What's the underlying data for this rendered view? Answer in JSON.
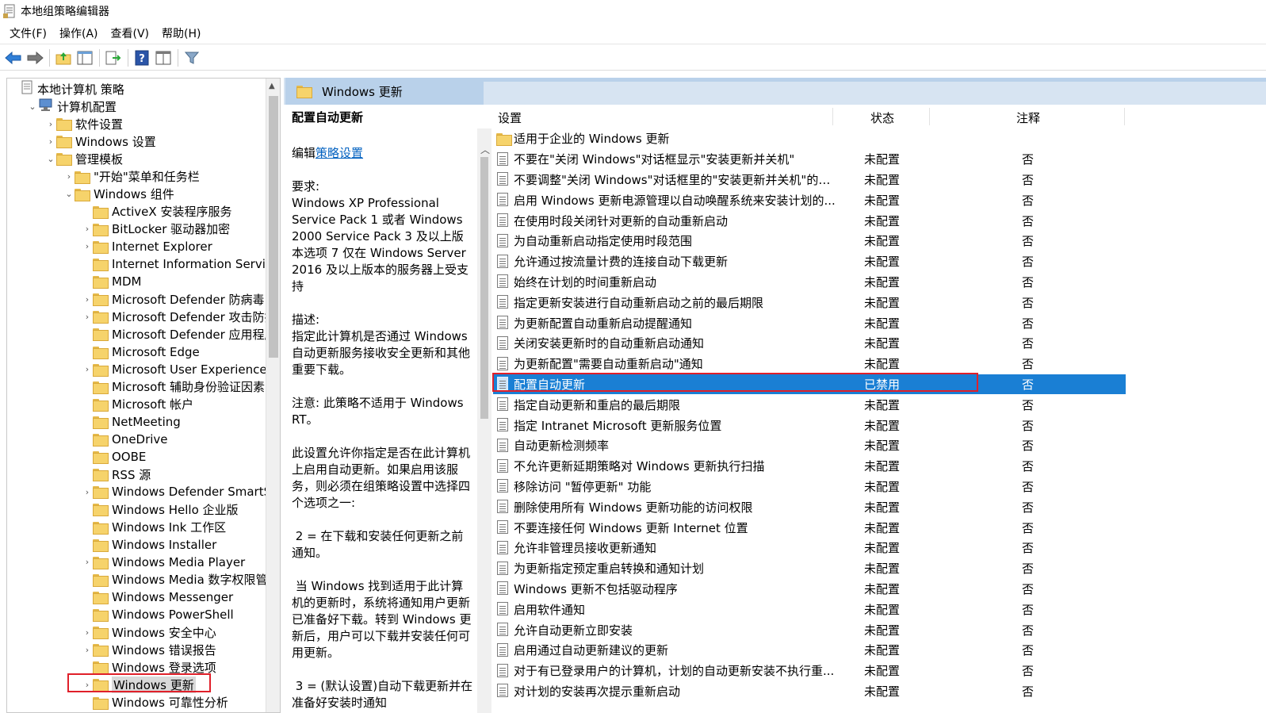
{
  "window": {
    "title": "本地组策略编辑器"
  },
  "menu": [
    "文件(F)",
    "操作(A)",
    "查看(V)",
    "帮助(H)"
  ],
  "toolbar": {
    "buttons": [
      {
        "name": "back-arrow-icon"
      },
      {
        "name": "forward-arrow-icon"
      },
      {
        "name": "up-folder-icon"
      },
      {
        "name": "show-hide-tree-icon"
      },
      {
        "name": "export-list-icon"
      },
      {
        "name": "help-icon"
      },
      {
        "name": "properties-view-icon"
      },
      {
        "name": "filter-icon"
      }
    ]
  },
  "tree": {
    "items": [
      {
        "label": "本地计算机 策略",
        "level": 0,
        "expander": "",
        "icon": "policy"
      },
      {
        "label": "计算机配置",
        "level": 1,
        "expander": "⌄",
        "icon": "computer"
      },
      {
        "label": "软件设置",
        "level": 2,
        "expander": "›",
        "icon": "folder"
      },
      {
        "label": "Windows 设置",
        "level": 2,
        "expander": "›",
        "icon": "folder"
      },
      {
        "label": "管理模板",
        "level": 2,
        "expander": "⌄",
        "icon": "folder"
      },
      {
        "label": "\"开始\"菜单和任务栏",
        "level": 3,
        "expander": "›",
        "icon": "folder"
      },
      {
        "label": "Windows 组件",
        "level": 3,
        "expander": "⌄",
        "icon": "folder"
      },
      {
        "label": "ActiveX 安装程序服务",
        "level": 4,
        "expander": "",
        "icon": "folder"
      },
      {
        "label": "BitLocker 驱动器加密",
        "level": 4,
        "expander": "›",
        "icon": "folder"
      },
      {
        "label": "Internet Explorer",
        "level": 4,
        "expander": "›",
        "icon": "folder"
      },
      {
        "label": "Internet Information Services",
        "level": 4,
        "expander": "",
        "icon": "folder"
      },
      {
        "label": "MDM",
        "level": 4,
        "expander": "",
        "icon": "folder"
      },
      {
        "label": "Microsoft Defender 防病毒",
        "level": 4,
        "expander": "›",
        "icon": "folder"
      },
      {
        "label": "Microsoft Defender 攻击防护",
        "level": 4,
        "expander": "›",
        "icon": "folder"
      },
      {
        "label": "Microsoft Defender 应用程序防",
        "level": 4,
        "expander": "",
        "icon": "folder"
      },
      {
        "label": "Microsoft Edge",
        "level": 4,
        "expander": "",
        "icon": "folder"
      },
      {
        "label": "Microsoft User Experience Virt",
        "level": 4,
        "expander": "›",
        "icon": "folder"
      },
      {
        "label": "Microsoft 辅助身份验证因素",
        "level": 4,
        "expander": "",
        "icon": "folder"
      },
      {
        "label": "Microsoft 帐户",
        "level": 4,
        "expander": "",
        "icon": "folder"
      },
      {
        "label": "NetMeeting",
        "level": 4,
        "expander": "",
        "icon": "folder"
      },
      {
        "label": "OneDrive",
        "level": 4,
        "expander": "",
        "icon": "folder"
      },
      {
        "label": "OOBE",
        "level": 4,
        "expander": "",
        "icon": "folder"
      },
      {
        "label": "RSS 源",
        "level": 4,
        "expander": "",
        "icon": "folder"
      },
      {
        "label": "Windows Defender SmartScre",
        "level": 4,
        "expander": "›",
        "icon": "folder"
      },
      {
        "label": "Windows Hello 企业版",
        "level": 4,
        "expander": "",
        "icon": "folder"
      },
      {
        "label": "Windows Ink 工作区",
        "level": 4,
        "expander": "",
        "icon": "folder"
      },
      {
        "label": "Windows Installer",
        "level": 4,
        "expander": "",
        "icon": "folder"
      },
      {
        "label": "Windows Media Player",
        "level": 4,
        "expander": "›",
        "icon": "folder"
      },
      {
        "label": "Windows Media 数字权限管理",
        "level": 4,
        "expander": "",
        "icon": "folder"
      },
      {
        "label": "Windows Messenger",
        "level": 4,
        "expander": "",
        "icon": "folder"
      },
      {
        "label": "Windows PowerShell",
        "level": 4,
        "expander": "",
        "icon": "folder"
      },
      {
        "label": "Windows 安全中心",
        "level": 4,
        "expander": "›",
        "icon": "folder"
      },
      {
        "label": "Windows 错误报告",
        "level": 4,
        "expander": "›",
        "icon": "folder"
      },
      {
        "label": "Windows 登录选项",
        "level": 4,
        "expander": "",
        "icon": "folder"
      },
      {
        "label": "Windows 更新",
        "level": 4,
        "expander": "›",
        "icon": "folder",
        "selected": true
      },
      {
        "label": "Windows 可靠性分析",
        "level": 4,
        "expander": "",
        "icon": "folder"
      }
    ]
  },
  "header": {
    "title": "Windows 更新"
  },
  "description": {
    "title": "配置自动更新",
    "edit_prefix": "编辑",
    "edit_link": "策略设置",
    "requirements": "要求:\nWindows XP Professional Service Pack 1 或者 Windows 2000 Service Pack 3 及以上版本选项 7 仅在 Windows Server 2016 及以上版本的服务器上受支持",
    "description_text": "描述:\n指定此计算机是否通过 Windows 自动更新服务接收安全更新和其他重要下载。",
    "note": "注意: 此策略不适用于 Windows RT。",
    "p1": "此设置允许你指定是否在此计算机上启用自动更新。如果启用该服务，则必须在组策略设置中选择四个选项之一:",
    "p2": " 2 = 在下载和安装任何更新之前通知。",
    "p3": " 当 Windows 找到适用于此计算机的更新时，系统将通知用户更新已准备好下载。转到 Windows 更新后，用户可以下载并安装任何可用更新。",
    "p4": " 3 = (默认设置)自动下载更新并在准备好安装时通知"
  },
  "list": {
    "columns": {
      "setting": "设置",
      "state": "状态",
      "comment": "注释"
    },
    "rows": [
      {
        "name": "适用于企业的 Windows 更新",
        "state": "",
        "comment": "",
        "icon": "folder"
      },
      {
        "name": "不要在\"关闭 Windows\"对话框显示\"安装更新并关机\"",
        "state": "未配置",
        "comment": "否",
        "icon": "policy"
      },
      {
        "name": "不要调整\"关闭 Windows\"对话框里的\"安装更新并关机\"的默...",
        "state": "未配置",
        "comment": "否",
        "icon": "policy"
      },
      {
        "name": "启用 Windows 更新电源管理以自动唤醒系统来安装计划的...",
        "state": "未配置",
        "comment": "否",
        "icon": "policy"
      },
      {
        "name": "在使用时段关闭针对更新的自动重新启动",
        "state": "未配置",
        "comment": "否",
        "icon": "policy"
      },
      {
        "name": "为自动重新启动指定使用时段范围",
        "state": "未配置",
        "comment": "否",
        "icon": "policy"
      },
      {
        "name": "允许通过按流量计费的连接自动下载更新",
        "state": "未配置",
        "comment": "否",
        "icon": "policy"
      },
      {
        "name": "始终在计划的时间重新启动",
        "state": "未配置",
        "comment": "否",
        "icon": "policy"
      },
      {
        "name": "指定更新安装进行自动重新启动之前的最后期限",
        "state": "未配置",
        "comment": "否",
        "icon": "policy"
      },
      {
        "name": "为更新配置自动重新启动提醒通知",
        "state": "未配置",
        "comment": "否",
        "icon": "policy"
      },
      {
        "name": "关闭安装更新时的自动重新启动通知",
        "state": "未配置",
        "comment": "否",
        "icon": "policy"
      },
      {
        "name": "为更新配置\"需要自动重新启动\"通知",
        "state": "未配置",
        "comment": "否",
        "icon": "policy"
      },
      {
        "name": "配置自动更新",
        "state": "已禁用",
        "comment": "否",
        "icon": "policy",
        "selected": true
      },
      {
        "name": "指定自动更新和重启的最后期限",
        "state": "未配置",
        "comment": "否",
        "icon": "policy"
      },
      {
        "name": "指定 Intranet Microsoft 更新服务位置",
        "state": "未配置",
        "comment": "否",
        "icon": "policy"
      },
      {
        "name": "自动更新检测频率",
        "state": "未配置",
        "comment": "否",
        "icon": "policy"
      },
      {
        "name": "不允许更新延期策略对 Windows 更新执行扫描",
        "state": "未配置",
        "comment": "否",
        "icon": "policy"
      },
      {
        "name": "移除访问 \"暂停更新\" 功能",
        "state": "未配置",
        "comment": "否",
        "icon": "policy"
      },
      {
        "name": "删除使用所有 Windows 更新功能的访问权限",
        "state": "未配置",
        "comment": "否",
        "icon": "policy"
      },
      {
        "name": "不要连接任何 Windows 更新 Internet 位置",
        "state": "未配置",
        "comment": "否",
        "icon": "policy"
      },
      {
        "name": "允许非管理员接收更新通知",
        "state": "未配置",
        "comment": "否",
        "icon": "policy"
      },
      {
        "name": "为更新指定预定重启转换和通知计划",
        "state": "未配置",
        "comment": "否",
        "icon": "policy"
      },
      {
        "name": "Windows 更新不包括驱动程序",
        "state": "未配置",
        "comment": "否",
        "icon": "policy"
      },
      {
        "name": "启用软件通知",
        "state": "未配置",
        "comment": "否",
        "icon": "policy"
      },
      {
        "name": "允许自动更新立即安装",
        "state": "未配置",
        "comment": "否",
        "icon": "policy"
      },
      {
        "name": "启用通过自动更新建议的更新",
        "state": "未配置",
        "comment": "否",
        "icon": "policy"
      },
      {
        "name": "对于有已登录用户的计算机，计划的自动更新安装不执行重...",
        "state": "未配置",
        "comment": "否",
        "icon": "policy"
      },
      {
        "name": "对计划的安装再次提示重新启动",
        "state": "未配置",
        "comment": "否",
        "icon": "policy"
      }
    ]
  },
  "colors": {
    "selection": "#1a7fd4",
    "highlight_box": "#e0202a",
    "header_band": "#d7e4f2"
  }
}
